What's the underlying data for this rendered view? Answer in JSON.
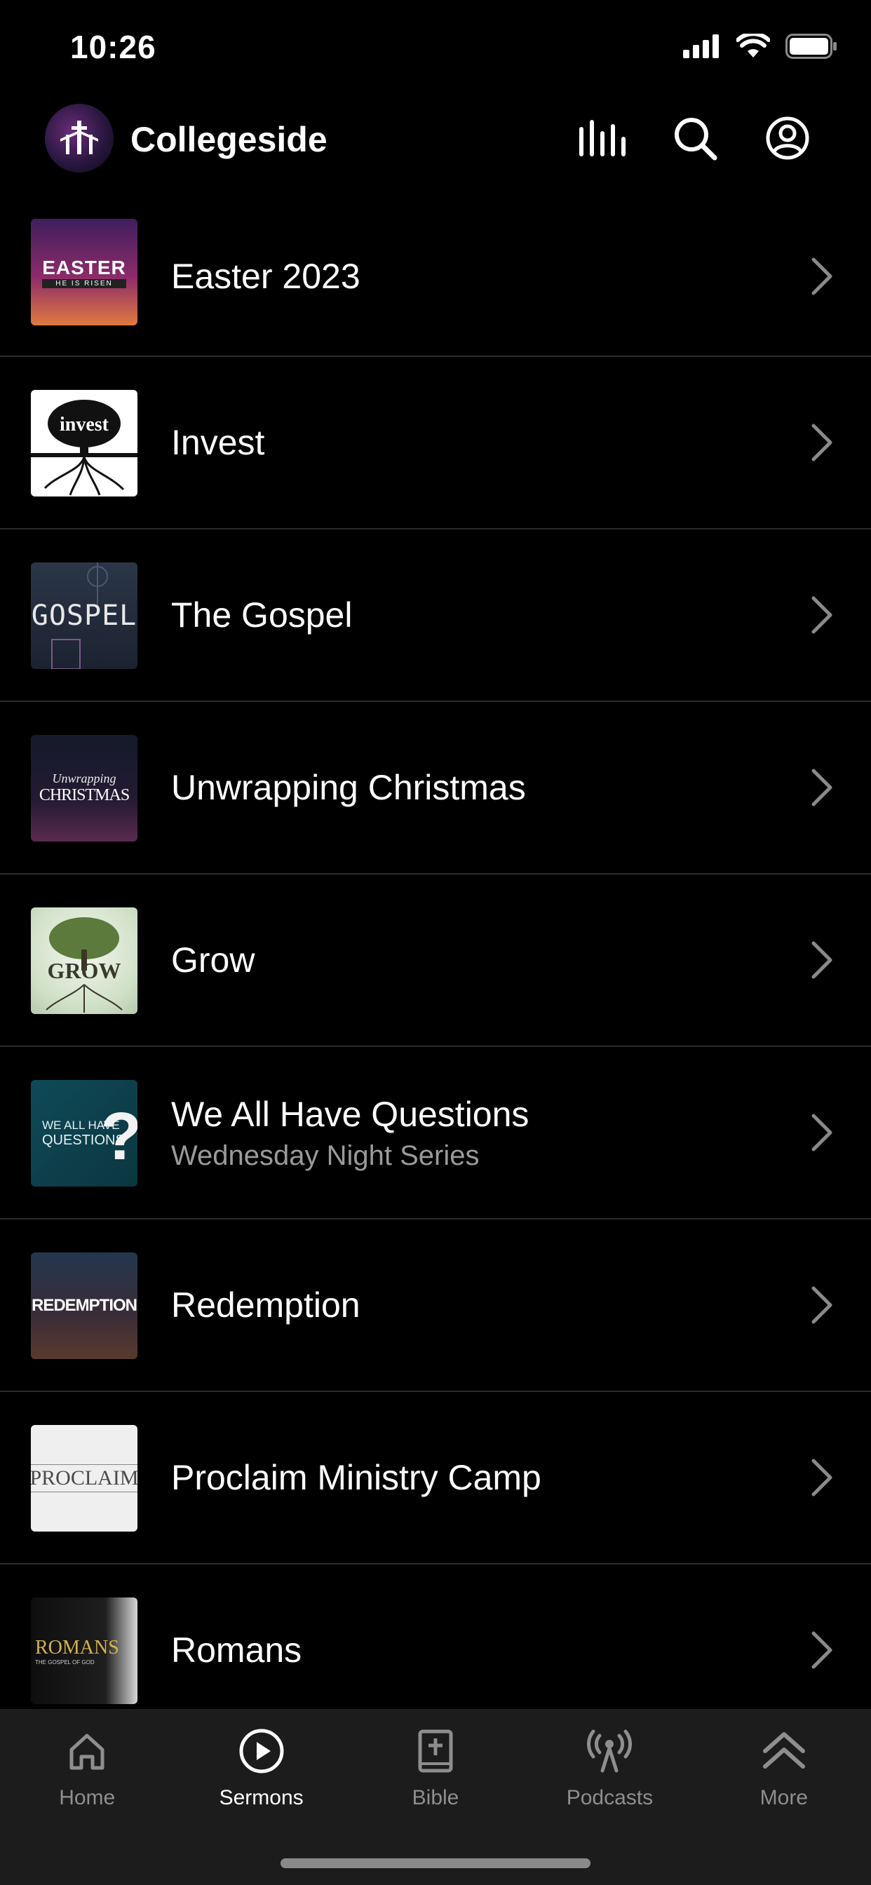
{
  "status_bar": {
    "time": "10:26"
  },
  "header": {
    "app_name": "Collegeside"
  },
  "series": [
    {
      "title": "Easter 2023",
      "subtitle": "",
      "art_text": "EASTER",
      "art_sub": "HE IS RISEN"
    },
    {
      "title": "Invest",
      "subtitle": "",
      "art_text": "invest"
    },
    {
      "title": "The Gospel",
      "subtitle": "",
      "art_text": "GOSPEL"
    },
    {
      "title": "Unwrapping Christmas",
      "subtitle": "",
      "art_text": "Unwrapping",
      "art_sub": "CHRISTMAS"
    },
    {
      "title": "Grow",
      "subtitle": "",
      "art_text": "GROW"
    },
    {
      "title": "We All Have Questions",
      "subtitle": "Wednesday Night Series",
      "art_text": "WE ALL HAVE",
      "art_sub": "QUESTIONS"
    },
    {
      "title": "Redemption",
      "subtitle": "",
      "art_text": "REDEMPTION"
    },
    {
      "title": "Proclaim Ministry Camp",
      "subtitle": "",
      "art_text": "PROCLAIM"
    },
    {
      "title": "Romans",
      "subtitle": "",
      "art_text": "ROMANS",
      "art_sub": "THE GOSPEL OF GOD"
    }
  ],
  "tabs": [
    {
      "label": "Home",
      "icon": "home-icon",
      "active": false
    },
    {
      "label": "Sermons",
      "icon": "play-circle-icon",
      "active": true
    },
    {
      "label": "Bible",
      "icon": "bible-icon",
      "active": false
    },
    {
      "label": "Podcasts",
      "icon": "podcast-icon",
      "active": false
    },
    {
      "label": "More",
      "icon": "chevron-up-icon",
      "active": false
    }
  ],
  "colors": {
    "background": "#000000",
    "divider": "#2b2b2b",
    "tab_bar": "#1c1c1c",
    "inactive": "#8e8e8e",
    "subtitle": "#9a9a9a"
  }
}
